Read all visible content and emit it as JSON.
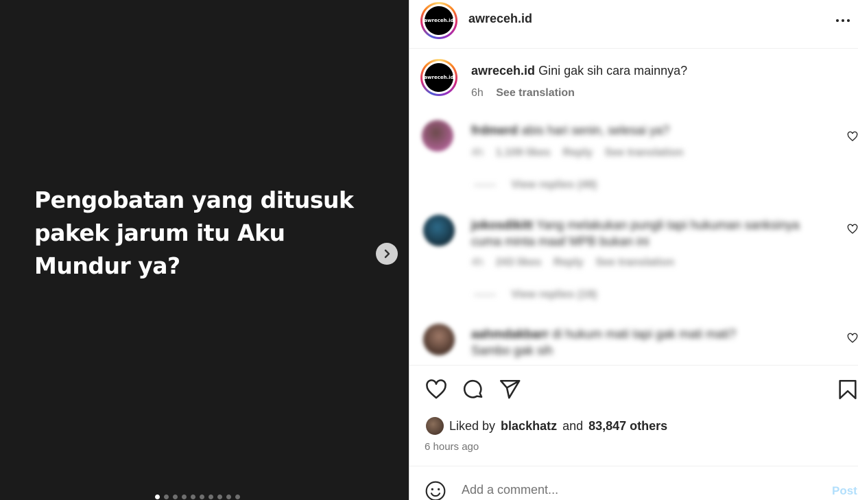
{
  "media": {
    "overlay_text": "Pengobatan yang ditusuk pakek jarum itu Aku Mundur ya?",
    "next_icon": "chevron-right-icon",
    "slide_count": 10,
    "active_slide": 1
  },
  "header": {
    "username": "awreceh.id",
    "avatar_text": "awreceh.id",
    "more_icon": "more-horizontal-icon"
  },
  "caption": {
    "username": "awreceh.id",
    "text": "Gini gak sih cara mainnya?",
    "time": "6h",
    "see_translation": "See translation"
  },
  "comments": [
    {
      "username": "frdmerd",
      "text": "abis hari senin, selesai ya?",
      "time": "4h",
      "likes": "1.109 likes",
      "reply": "Reply",
      "see_translation": "See translation",
      "view_replies": "View replies (49)"
    },
    {
      "username": "jokosdikitt",
      "text": "Yang melakukan pungli tapi hukuman sanksinya cuma minta maaf MPB bukan ini",
      "time": "4h",
      "likes": "243 likes",
      "reply": "Reply",
      "see_translation": "See translation",
      "view_replies": "View replies (19)"
    },
    {
      "username": "aahmdakbarr",
      "text": "di hukum mati tapi gak mati mati?",
      "text2": "Sambo gak sih"
    }
  ],
  "actions": {
    "like_icon": "heart-icon",
    "comment_icon": "comment-icon",
    "share_icon": "send-icon",
    "save_icon": "bookmark-icon"
  },
  "likes": {
    "prefix": "Liked by",
    "user": "blackhatz",
    "conj": "and",
    "others": "83,847 others"
  },
  "time_ago": "6 hours ago",
  "comment_box": {
    "placeholder": "Add a comment...",
    "post_label": "Post",
    "emoji_icon": "emoji-icon"
  },
  "colors": {
    "media_bg": "#1b1b1b",
    "post_disabled": "#b2dffc",
    "muted": "#737373"
  }
}
